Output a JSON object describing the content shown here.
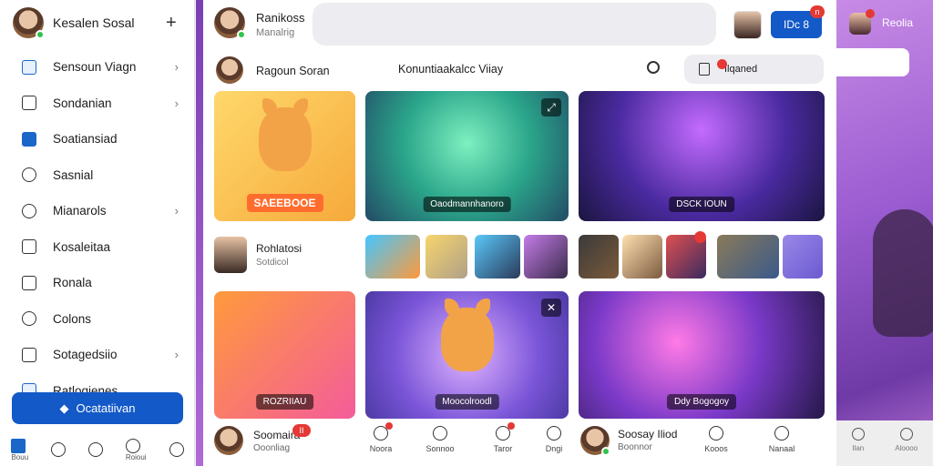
{
  "sidebar": {
    "profile_name": "Kesalen Sosal",
    "items": [
      {
        "label": "Sensoun Viagn",
        "chevron": true,
        "icon": "news-icon"
      },
      {
        "label": "Sondanian",
        "chevron": true,
        "icon": "page-icon"
      },
      {
        "label": "Soatiansiad",
        "chevron": false,
        "icon": "check-icon"
      },
      {
        "label": "Sasnial",
        "chevron": false,
        "icon": "shield-icon"
      },
      {
        "label": "Mianarols",
        "chevron": true,
        "icon": "bell-icon"
      },
      {
        "label": "Kosaleitaa",
        "chevron": false,
        "icon": "inbox-icon"
      },
      {
        "label": "Ronala",
        "chevron": false,
        "icon": "lock-icon"
      },
      {
        "label": "Colons",
        "chevron": false,
        "icon": "user-icon"
      },
      {
        "label": "Sotagedsiio",
        "chevron": true,
        "icon": "check-box-icon"
      },
      {
        "label": "Ratlogienes",
        "chevron": false,
        "icon": "app-icon"
      }
    ],
    "cta_label": "Ocatatiivan",
    "bottom_nav": [
      {
        "label": "Bouu",
        "icon": "home-icon"
      },
      {
        "label": "",
        "icon": "search-icon"
      },
      {
        "label": "",
        "icon": "messenger-icon"
      },
      {
        "label": "Roioui",
        "icon": "notifications-icon"
      },
      {
        "label": "",
        "icon": "profile-icon"
      }
    ]
  },
  "main": {
    "header": {
      "name": "Ranikoss",
      "sub": "Manalrig",
      "button_label": "IDc 8",
      "badge": "n"
    },
    "row2": {
      "name": "Ragoun Soran",
      "title": "Konuntiaakalcc Viiay",
      "pill_label": "Ilqaned"
    },
    "cards_top": [
      {
        "label": "SAEEBOOE"
      },
      {
        "label": "Oaodmannhanoro"
      },
      {
        "label": "DSCK IOUN"
      }
    ],
    "mid": {
      "name": "Rohlatosi",
      "sub": "Sotdicol"
    },
    "cards_bottom": [
      {
        "label": "ROZRIIAU"
      },
      {
        "label": "Moocolroodl"
      },
      {
        "label": "Ddy Bogogoy"
      }
    ],
    "bottom": {
      "name": "Soomaira",
      "sub": "Ooonliag",
      "badge": "II",
      "tabs": [
        {
          "label": "Noora"
        },
        {
          "label": "Sonnoo"
        },
        {
          "label": "Taror"
        },
        {
          "label": "Dngi"
        }
      ],
      "user_name": "Soosay Iliod",
      "user_sub": "Boonnor",
      "tabs2": [
        {
          "label": "Kooos"
        },
        {
          "label": "Nanaal"
        }
      ]
    }
  },
  "right": {
    "name": "Reolia",
    "bottom_tabs": [
      {
        "label": "Ilan"
      },
      {
        "label": "Aloooo"
      }
    ]
  }
}
